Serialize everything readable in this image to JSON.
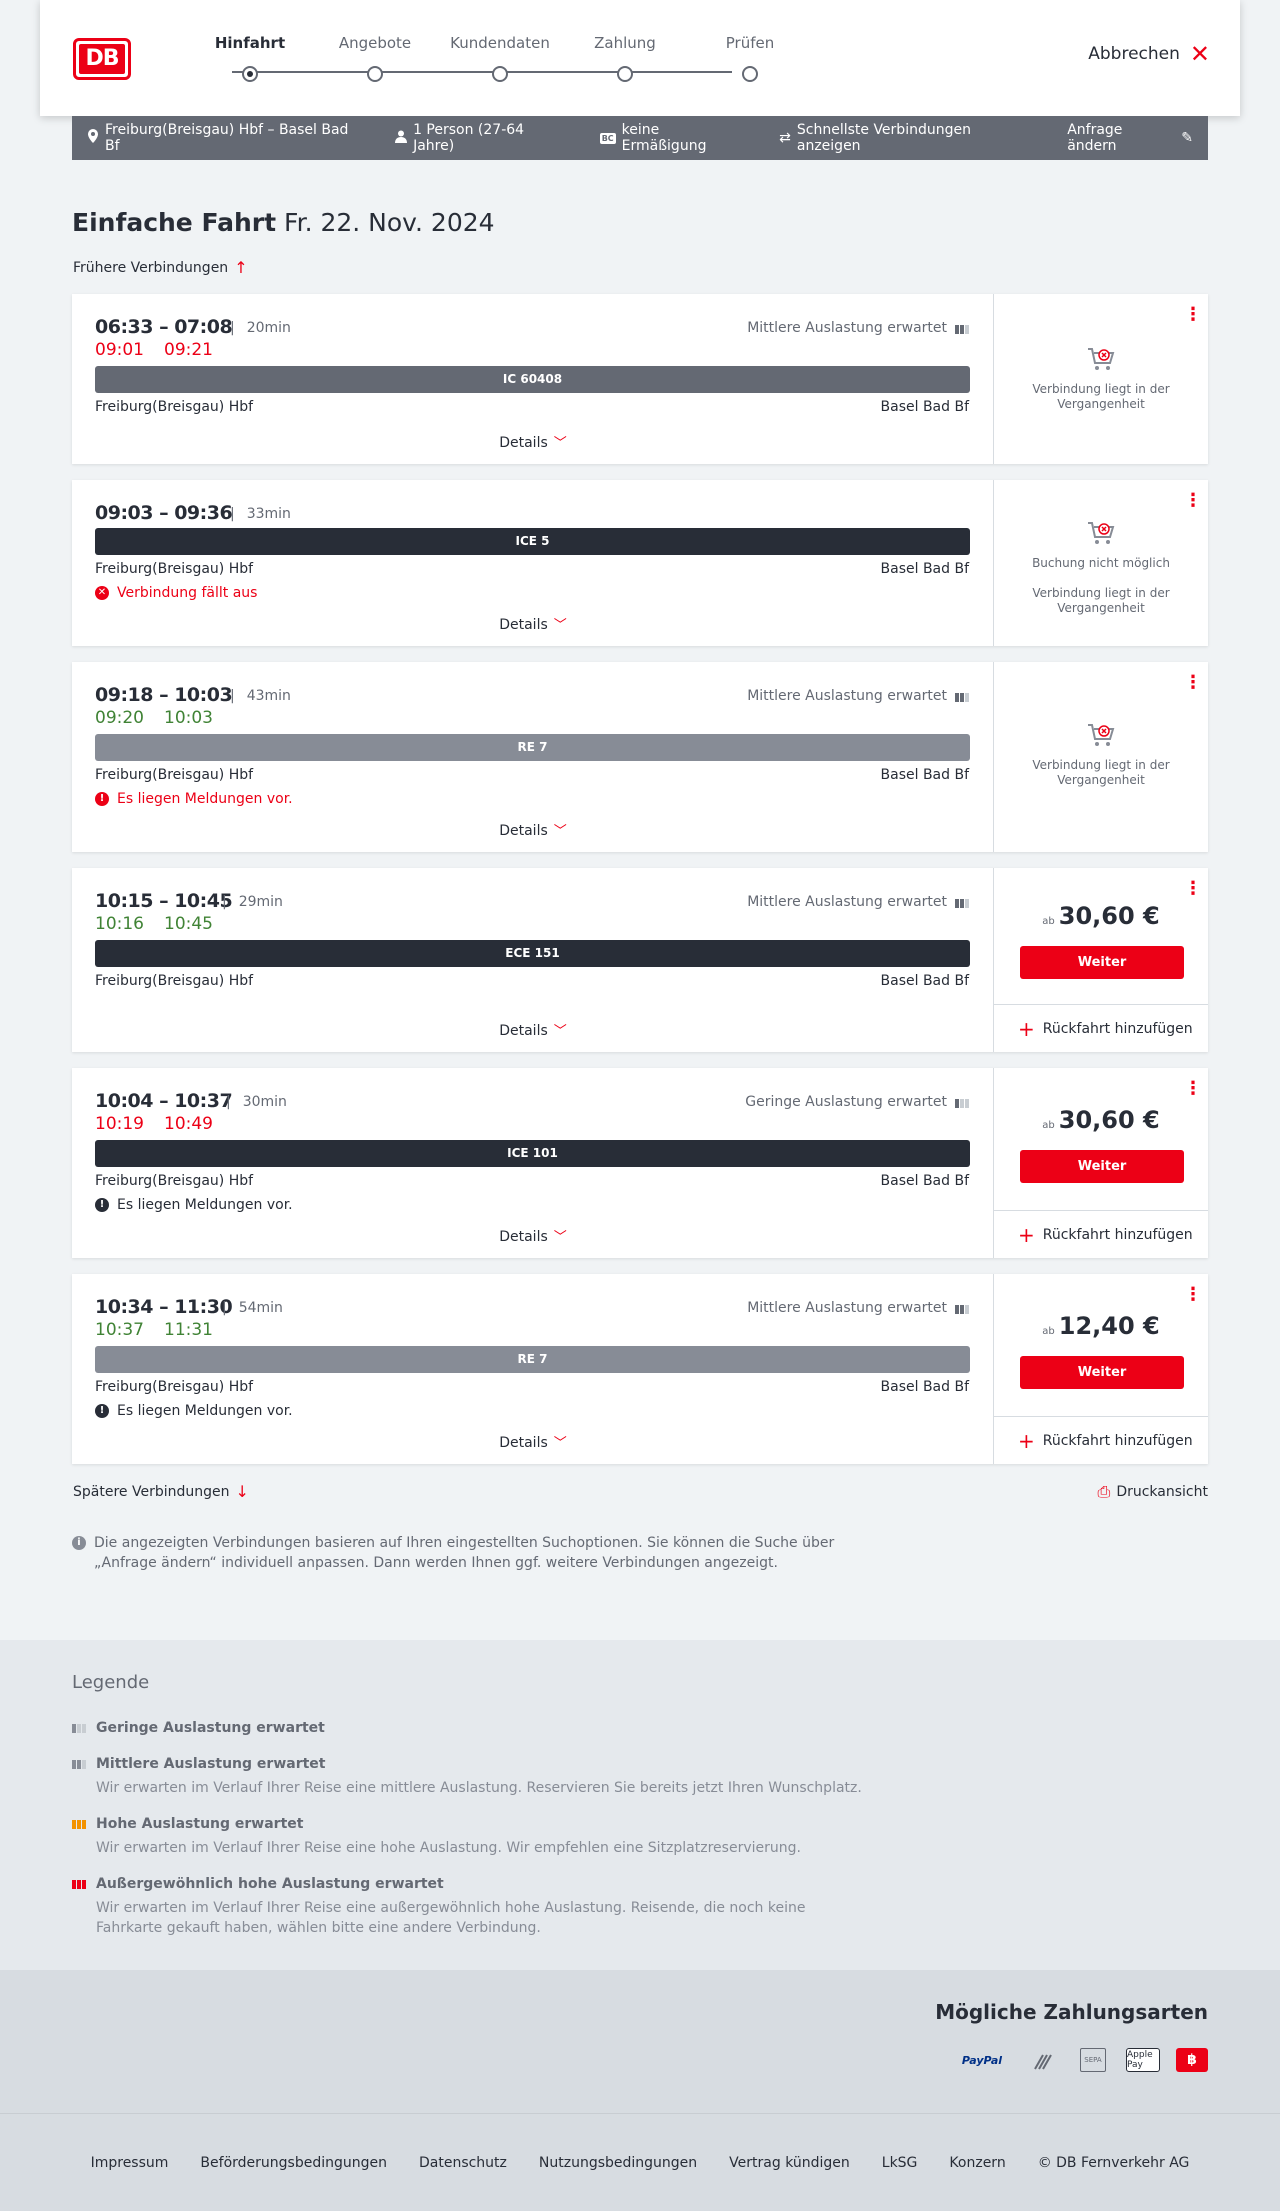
{
  "brand": {
    "logo": "DB"
  },
  "steps": [
    {
      "label": "Hinfahrt",
      "active": true
    },
    {
      "label": "Angebote"
    },
    {
      "label": "Kundendaten"
    },
    {
      "label": "Zahlung"
    },
    {
      "label": "Prüfen"
    }
  ],
  "cancel_label": "Abbrechen",
  "search": {
    "route": "Freiburg(Breisgau) Hbf – Basel Bad Bf",
    "persons": "1 Person (27-64 Jahre)",
    "discount_badge": "BC",
    "discount": "keine Ermäßigung",
    "fastest": "Schnellste Verbindungen anzeigen",
    "change": "Anfrage ändern"
  },
  "page": {
    "title": "Einfache Fahrt",
    "date": "Fr. 22. Nov. 2024",
    "earlier": "Frühere Verbindungen",
    "later": "Spätere Verbindungen",
    "print": "Druckansicht",
    "details": "Details"
  },
  "connections": [
    {
      "times": "06:33 – 07:08",
      "duration": "20min",
      "real_dep": "09:01",
      "real_arr": "09:21",
      "real_color": "red",
      "load": "Mittlere Auslastung erwartet",
      "train": "IC 60408",
      "train_style": "gr",
      "from": "Freiburg(Breisgau) Hbf",
      "to": "Basel Bad Bf",
      "status": [
        "Verbindung liegt in der Vergangenheit"
      ]
    },
    {
      "times": "09:03 – 09:36",
      "duration": "33min",
      "train": "ICE 5",
      "train_style": "dk",
      "from": "Freiburg(Breisgau) Hbf",
      "to": "Basel Bad Bf",
      "message": "Verbindung fällt aus",
      "message_color": "red",
      "status": [
        "Buchung nicht möglich",
        "Verbindung liegt in der Vergangenheit"
      ]
    },
    {
      "times": "09:18 – 10:03",
      "duration": "43min",
      "real_dep": "09:20",
      "real_arr": "10:03",
      "real_color": "green",
      "load": "Mittlere Auslastung erwartet",
      "train": "RE 7",
      "train_style": "lg",
      "from": "Freiburg(Breisgau) Hbf",
      "to": "Basel Bad Bf",
      "message": "Es liegen Meldungen vor.",
      "message_color": "red",
      "status": [
        "Verbindung liegt in der Vergangenheit"
      ]
    },
    {
      "times": "10:15 – 10:45",
      "duration": "29min",
      "real_dep": "10:16",
      "real_arr": "10:45",
      "real_color": "green",
      "load": "Mittlere Auslastung erwartet",
      "train": "ECE 151",
      "train_style": "dk",
      "from": "Freiburg(Breisgau) Hbf",
      "to": "Basel Bad Bf",
      "price_prefix": "ab",
      "price": "30,60 €",
      "cta": "Weiter",
      "return": "Rückfahrt hinzufügen"
    },
    {
      "times": "10:04 – 10:37",
      "duration": "30min",
      "real_dep": "10:19",
      "real_arr": "10:49",
      "real_color": "red",
      "load": "Geringe Auslastung erwartet",
      "load_level": "low",
      "train": "ICE 101",
      "train_style": "dk",
      "from": "Freiburg(Breisgau) Hbf",
      "to": "Basel Bad Bf",
      "message": "Es liegen Meldungen vor.",
      "message_color": "black",
      "price_prefix": "ab",
      "price": "30,60 €",
      "cta": "Weiter",
      "return": "Rückfahrt hinzufügen"
    },
    {
      "times": "10:34 – 11:30",
      "duration": "54min",
      "real_dep": "10:37",
      "real_arr": "11:31",
      "real_color": "green",
      "load": "Mittlere Auslastung erwartet",
      "train": "RE 7",
      "train_style": "lg",
      "from": "Freiburg(Breisgau) Hbf",
      "to": "Basel Bad Bf",
      "message": "Es liegen Meldungen vor.",
      "message_color": "black",
      "price_prefix": "ab",
      "price": "12,40 €",
      "cta": "Weiter",
      "return": "Rückfahrt hinzufügen"
    }
  ],
  "info_text": "Die angezeigten Verbindungen basieren auf Ihren eingestellten Suchoptionen. Sie können die Suche über „Anfrage ändern“ individuell anpassen. Dann werden Ihnen ggf. weitere Verbindungen angezeigt.",
  "legend": {
    "title": "Legende",
    "items": [
      {
        "title": "Geringe Auslastung erwartet",
        "desc": "",
        "color": "#878c96",
        "level": 1
      },
      {
        "title": "Mittlere Auslastung erwartet",
        "desc": "Wir erwarten im Verlauf Ihrer Reise eine mittlere Auslastung. Reservieren Sie bereits jetzt Ihren Wunschplatz.",
        "color": "#878c96",
        "level": 2
      },
      {
        "title": "Hohe Auslastung erwartet",
        "desc": "Wir erwarten im Verlauf Ihrer Reise eine hohe Auslastung. Wir empfehlen eine Sitzplatzreservierung.",
        "color": "#f39200",
        "level": 3
      },
      {
        "title": "Außergewöhnlich hohe Auslastung erwartet",
        "desc": "Wir erwarten im Verlauf Ihrer Reise eine außergewöhnlich hohe Auslastung. Reisende, die noch keine Fahrkarte gekauft haben, wählen bitte eine andere Verbindung.",
        "color": "#ec0016",
        "level": 4
      }
    ]
  },
  "payment": {
    "title": "Mögliche Zahlungsarten",
    "methods": [
      "PayPal",
      "Kreditkarte",
      "SEPA",
      "Apple Pay",
      "DB Bonus"
    ]
  },
  "footer": [
    "Impressum",
    "Beförderungsbedingungen",
    "Datenschutz",
    "Nutzungsbedingungen",
    "Vertrag kündigen",
    "LkSG",
    "Konzern",
    "© DB Fernverkehr AG"
  ]
}
